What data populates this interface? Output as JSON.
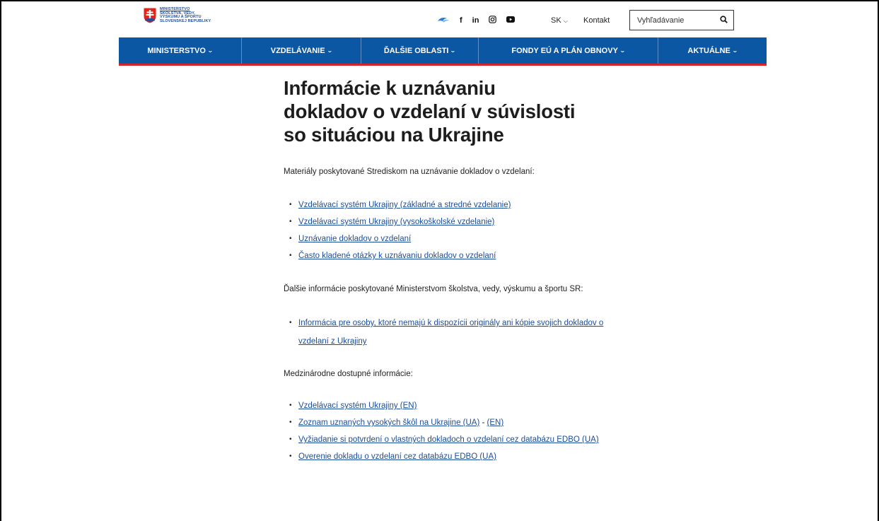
{
  "header": {
    "logo_lines": [
      "MINISTERSTVO",
      "ŠKOLSTVA, VEDY,",
      "VÝSKUMU A ŠPORTU",
      "SLOVENSKEJ REPUBLIKY"
    ],
    "social_icons": [
      "eu-bird-icon",
      "facebook-icon",
      "linkedin-icon",
      "instagram-icon",
      "youtube-icon"
    ],
    "lang_label": "SK",
    "contact_label": "Kontakt",
    "search_placeholder": "Vyhľadávanie"
  },
  "nav": {
    "items": [
      "MINISTERSTVO",
      "VZDELÁVANIE",
      "ĎALŠIE OBLASTI",
      "FONDY EÚ A PLÁN OBNOVY",
      "AKTUÁLNE"
    ]
  },
  "colors": {
    "nav_bg": "#0b57a4",
    "accent_red": "#d3262a",
    "link": "#1a4d99"
  },
  "main": {
    "title_lines": [
      "Informácie k uznávaniu",
      "dokladov o vzdelaní v súvislosti",
      "so situáciou na Ukrajine"
    ],
    "section1_intro": "Materiály poskytované Strediskom na uznávanie dokladov o vzdelaní:",
    "section1_links": [
      "Vzdelávací systém Ukrajiny (základné a stredné vzdelanie)",
      "Vzdelávací systém Ukrajiny (vysokoškolské vzdelanie)",
      "Uznávanie dokladov o vzdelaní",
      "Často kladené otázky k uznávaniu dokladov o vzdelaní"
    ],
    "section2_intro": "Ďalšie informácie poskytované Ministerstvom školstva, vedy, výskumu a športu SR:",
    "section2_links": [
      "Informácia pre osoby, ktoré nemajú k dispozícii originály ani kópie svojich dokladov o vzdelaní z Ukrajiny"
    ],
    "section3_intro": "Medzinárodne dostupné informácie:",
    "section3_links": {
      "l1": "Vzdelávací systém Ukrajiny (EN)",
      "l2a": "Zoznam uznaných vysokých škôl na Ukrajine (UA)",
      "l2sep": " - ",
      "l2b": "(EN)",
      "l3": "Vyžiadanie si potvrdení o vlastných dokladoch o vzdelaní cez databázu EDBO (UA)",
      "l4": "Overenie dokladu o vzdelaní cez databázu EDBO (UA)"
    }
  }
}
